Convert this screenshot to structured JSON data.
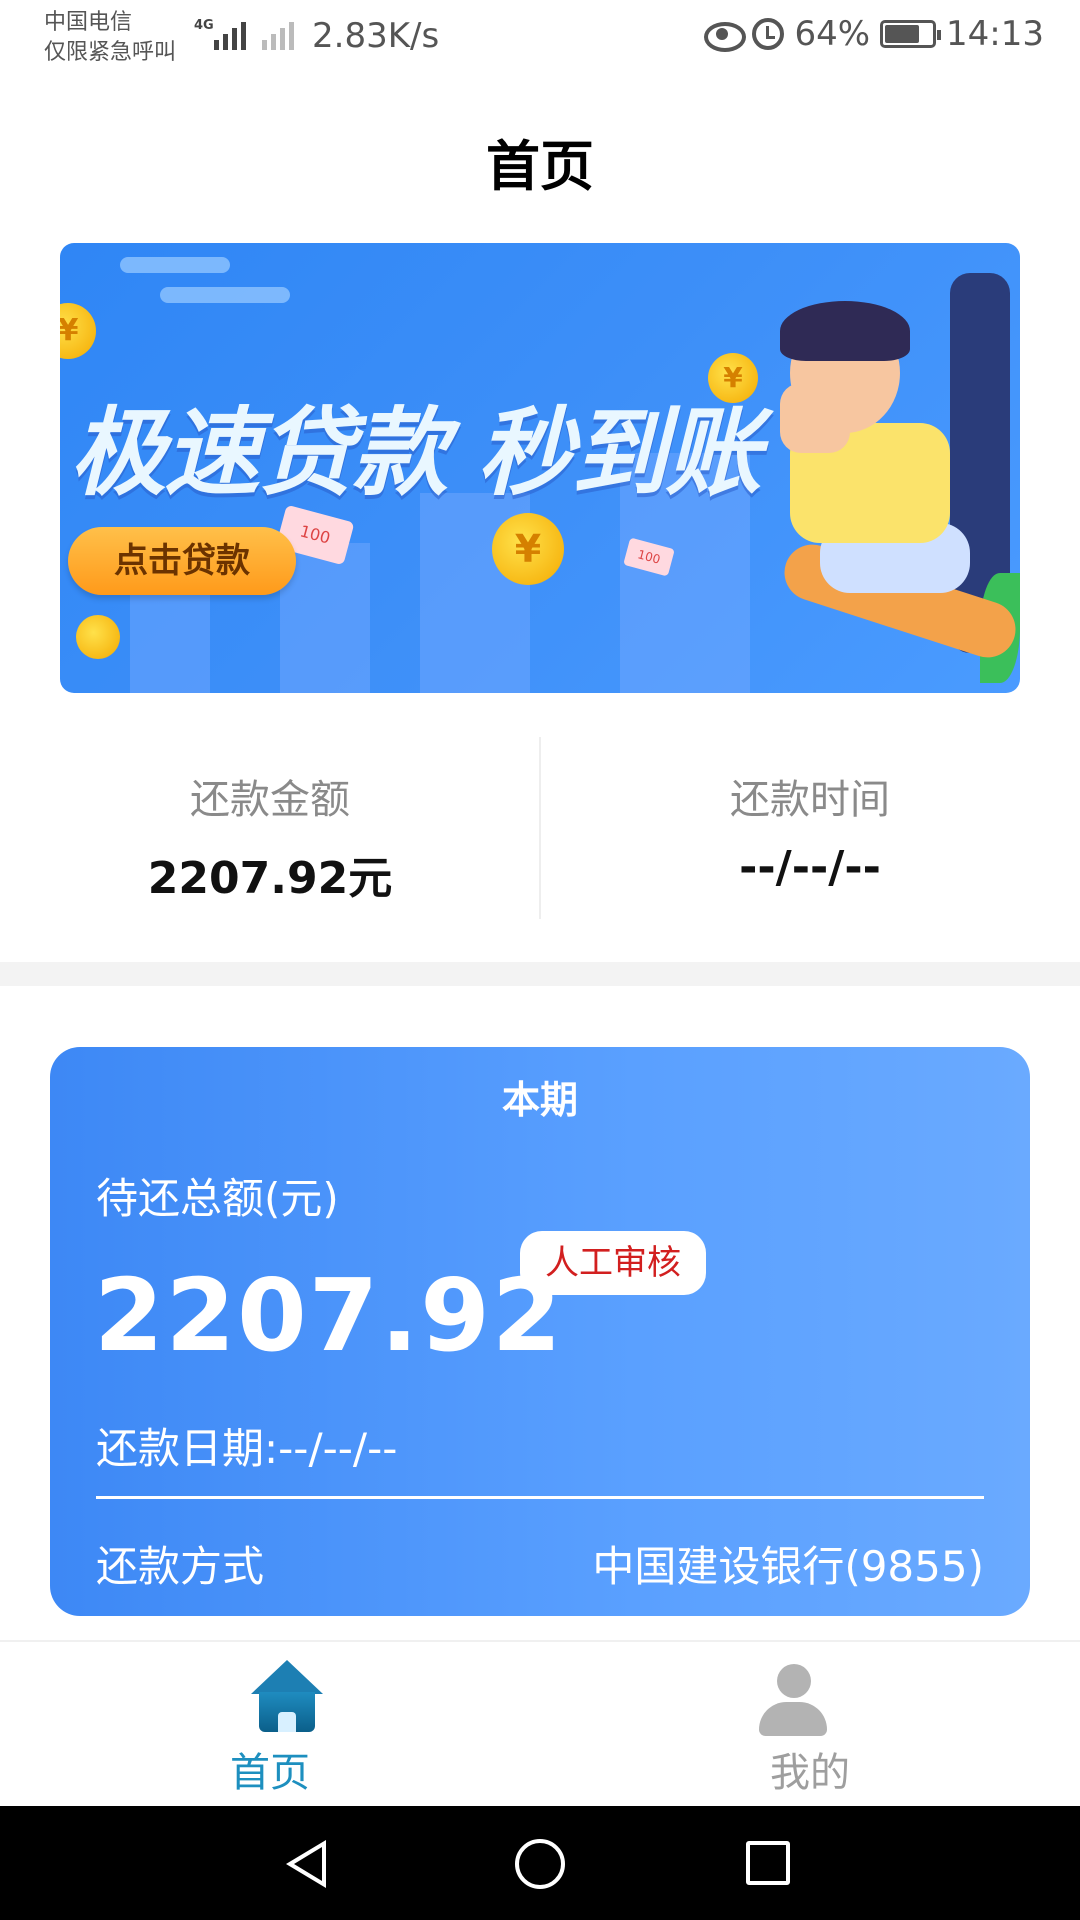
{
  "status_bar": {
    "carrier_line1": "中国电信",
    "carrier_line2": "仅限紧急呼叫",
    "network_tag": "4G",
    "net_speed": "2.83K/s",
    "battery": "64%",
    "time": "14:13"
  },
  "header": {
    "title": "首页"
  },
  "banner": {
    "headline": "极速贷款 秒到账",
    "button_label": "点击贷款",
    "coin_symbol": "¥",
    "note_label": "100"
  },
  "summary": {
    "amount_label": "还款金额",
    "amount_value": "2207.92元",
    "time_label": "还款时间",
    "time_value": "--/--/--"
  },
  "period_card": {
    "title": "本期",
    "due_label": "待还总额(元)",
    "due_amount": "2207.92",
    "review_badge": "人工审核",
    "due_date": "还款日期:--/--/--",
    "pay_method_label": "还款方式",
    "pay_method_value": "中国建设银行(9855)"
  },
  "bottom_nav": {
    "items": [
      {
        "label": "首页",
        "icon": "home-icon",
        "active": true
      },
      {
        "label": "我的",
        "icon": "user-icon",
        "active": false
      }
    ]
  },
  "colors": {
    "accent": "#3d88f5",
    "active_nav": "#1d8fbf",
    "inactive_nav": "#9e9e9e",
    "badge_text": "#d21f1f"
  }
}
